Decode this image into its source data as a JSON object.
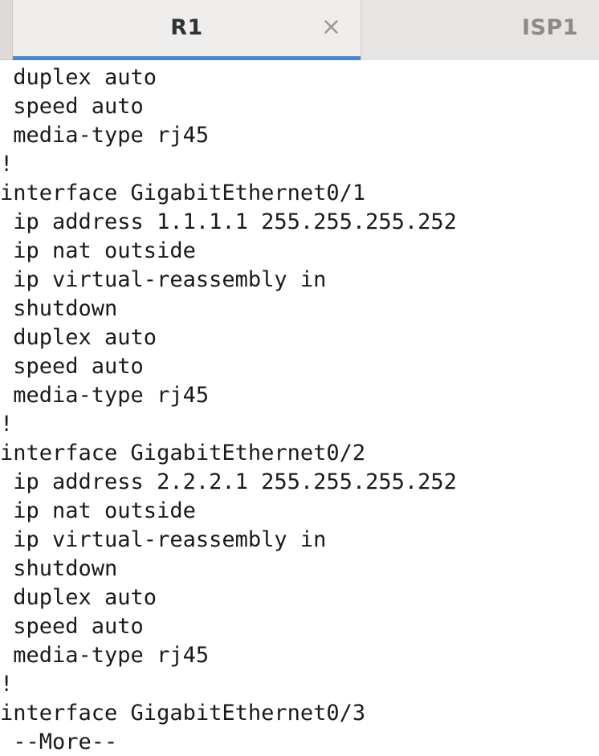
{
  "tabs": [
    {
      "label": "R1",
      "active": true,
      "close_icon": "close-icon"
    },
    {
      "label": "ISP1",
      "active": false
    }
  ],
  "colors": {
    "active_tab_indicator": "#4a86d6",
    "tabbar_background": "#e6e5e4",
    "terminal_background": "#ffffff",
    "terminal_text": "#1a1a1a"
  },
  "terminal": {
    "lines": [
      " duplex auto",
      " speed auto",
      " media-type rj45",
      "!",
      "interface GigabitEthernet0/1",
      " ip address 1.1.1.1 255.255.255.252",
      " ip nat outside",
      " ip virtual-reassembly in",
      " shutdown",
      " duplex auto",
      " speed auto",
      " media-type rj45",
      "!",
      "interface GigabitEthernet0/2",
      " ip address 2.2.2.1 255.255.255.252",
      " ip nat outside",
      " ip virtual-reassembly in",
      " shutdown",
      " duplex auto",
      " speed auto",
      " media-type rj45",
      "!",
      "interface GigabitEthernet0/3",
      " --More--"
    ]
  }
}
